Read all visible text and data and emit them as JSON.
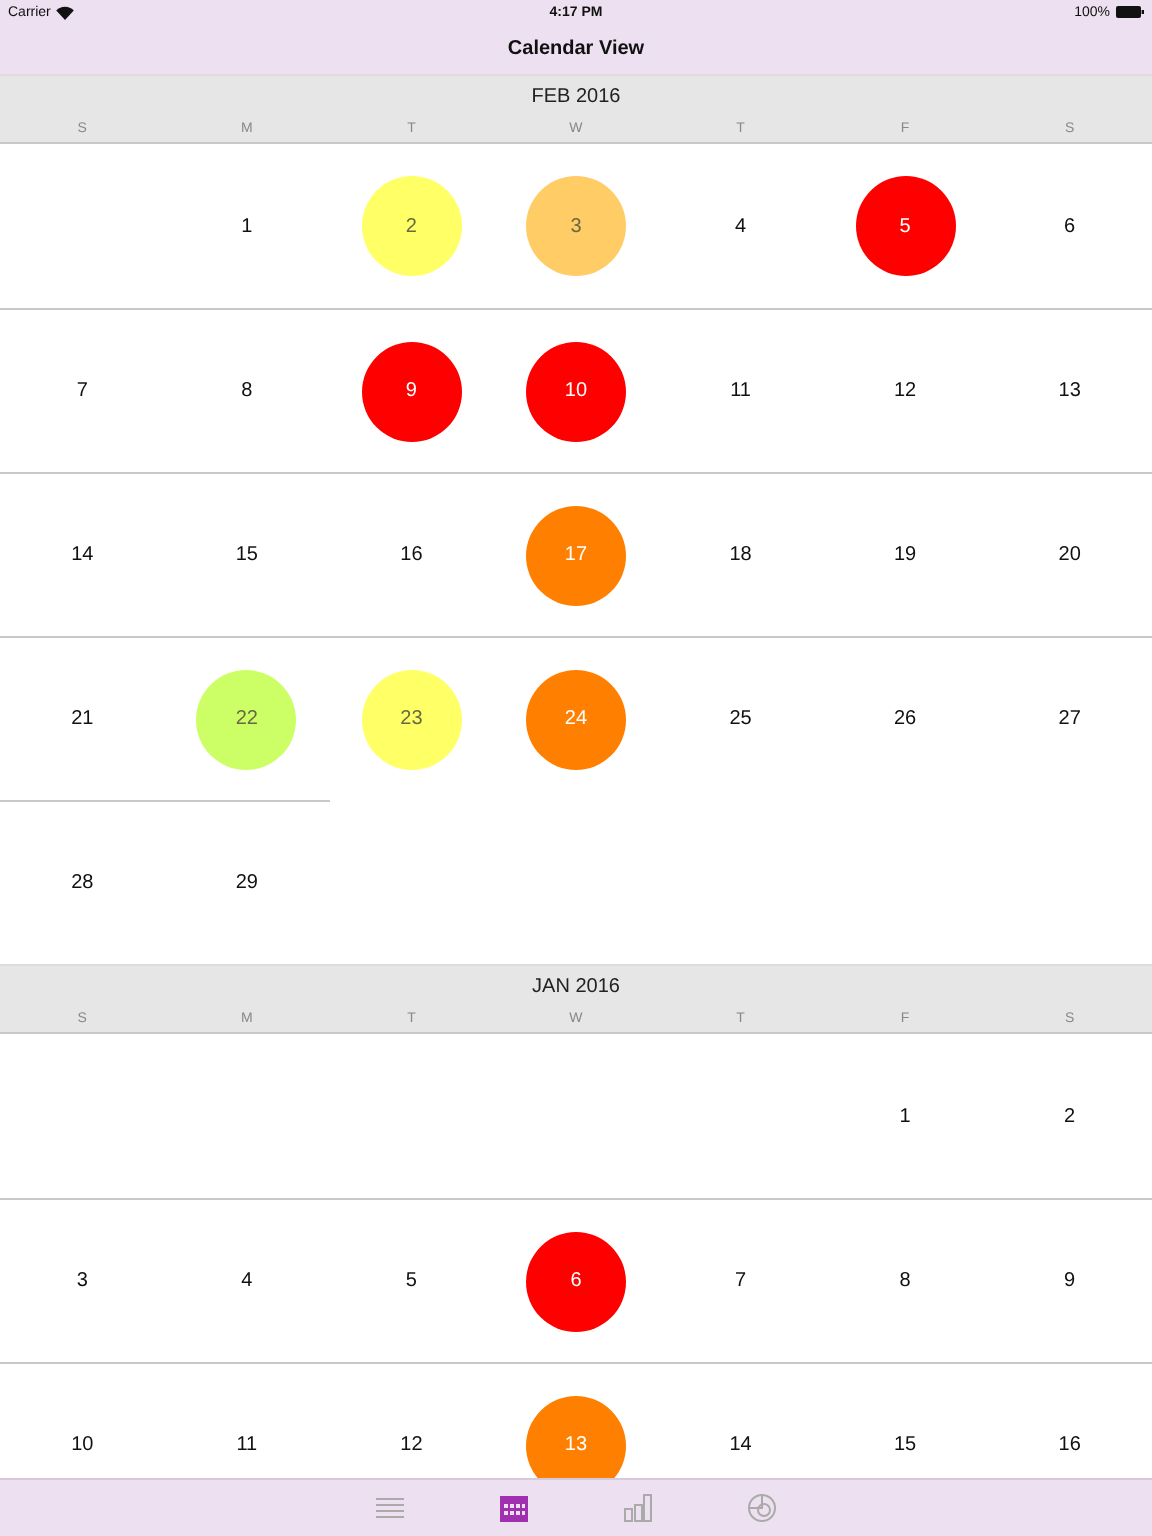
{
  "status_bar": {
    "carrier": "Carrier",
    "time": "4:17 PM",
    "battery": "100%"
  },
  "title": "Calendar View",
  "months": [
    {
      "title": "FEB 2016",
      "weekdays": [
        "S",
        "M",
        "T",
        "W",
        "T",
        "F",
        "S"
      ],
      "weeks": [
        [
          {
            "kind": "empty"
          },
          {
            "kind": "day",
            "day": "1"
          },
          {
            "kind": "day",
            "day": "2",
            "color": "#ffff66"
          },
          {
            "kind": "day",
            "day": "3",
            "color": "#ffcc66"
          },
          {
            "kind": "day",
            "day": "4"
          },
          {
            "kind": "day",
            "day": "5",
            "color": "#ff0000"
          },
          {
            "kind": "day",
            "day": "6"
          }
        ],
        [
          {
            "kind": "day",
            "day": "7"
          },
          {
            "kind": "day",
            "day": "8"
          },
          {
            "kind": "day",
            "day": "9",
            "color": "#ff0000"
          },
          {
            "kind": "day",
            "day": "10",
            "color": "#ff0000"
          },
          {
            "kind": "day",
            "day": "11"
          },
          {
            "kind": "day",
            "day": "12"
          },
          {
            "kind": "day",
            "day": "13"
          }
        ],
        [
          {
            "kind": "day",
            "day": "14"
          },
          {
            "kind": "day",
            "day": "15"
          },
          {
            "kind": "day",
            "day": "16"
          },
          {
            "kind": "day",
            "day": "17",
            "color": "#ff8000"
          },
          {
            "kind": "day",
            "day": "18"
          },
          {
            "kind": "day",
            "day": "19"
          },
          {
            "kind": "day",
            "day": "20"
          }
        ],
        [
          {
            "kind": "day",
            "day": "21"
          },
          {
            "kind": "day",
            "day": "22",
            "color": "#ccff66"
          },
          {
            "kind": "day",
            "day": "23",
            "color": "#ffff66"
          },
          {
            "kind": "day",
            "day": "24",
            "color": "#ff8000"
          },
          {
            "kind": "day",
            "day": "25"
          },
          {
            "kind": "day",
            "day": "26"
          },
          {
            "kind": "day",
            "day": "27"
          }
        ],
        [
          {
            "kind": "day",
            "day": "28"
          },
          {
            "kind": "day",
            "day": "29"
          },
          {
            "kind": "empty"
          },
          {
            "kind": "empty"
          },
          {
            "kind": "empty"
          },
          {
            "kind": "empty"
          },
          {
            "kind": "empty"
          }
        ]
      ]
    },
    {
      "title": "JAN 2016",
      "weekdays": [
        "S",
        "M",
        "T",
        "W",
        "T",
        "F",
        "S"
      ],
      "weeks": [
        [
          {
            "kind": "empty"
          },
          {
            "kind": "empty"
          },
          {
            "kind": "empty"
          },
          {
            "kind": "empty"
          },
          {
            "kind": "empty"
          },
          {
            "kind": "day",
            "day": "1"
          },
          {
            "kind": "day",
            "day": "2"
          }
        ],
        [
          {
            "kind": "day",
            "day": "3"
          },
          {
            "kind": "day",
            "day": "4"
          },
          {
            "kind": "day",
            "day": "5"
          },
          {
            "kind": "day",
            "day": "6",
            "color": "#ff0000"
          },
          {
            "kind": "day",
            "day": "7"
          },
          {
            "kind": "day",
            "day": "8"
          },
          {
            "kind": "day",
            "day": "9"
          }
        ],
        [
          {
            "kind": "day",
            "day": "10"
          },
          {
            "kind": "day",
            "day": "11"
          },
          {
            "kind": "day",
            "day": "12"
          },
          {
            "kind": "day",
            "day": "13",
            "color": "#ff8000"
          },
          {
            "kind": "day",
            "day": "14"
          },
          {
            "kind": "day",
            "day": "15"
          },
          {
            "kind": "day",
            "day": "16"
          }
        ]
      ]
    }
  ],
  "tabs": [
    {
      "kind": "list",
      "selected": false
    },
    {
      "kind": "calendar",
      "selected": true
    },
    {
      "kind": "chart",
      "selected": false
    },
    {
      "kind": "disc",
      "selected": false
    }
  ]
}
